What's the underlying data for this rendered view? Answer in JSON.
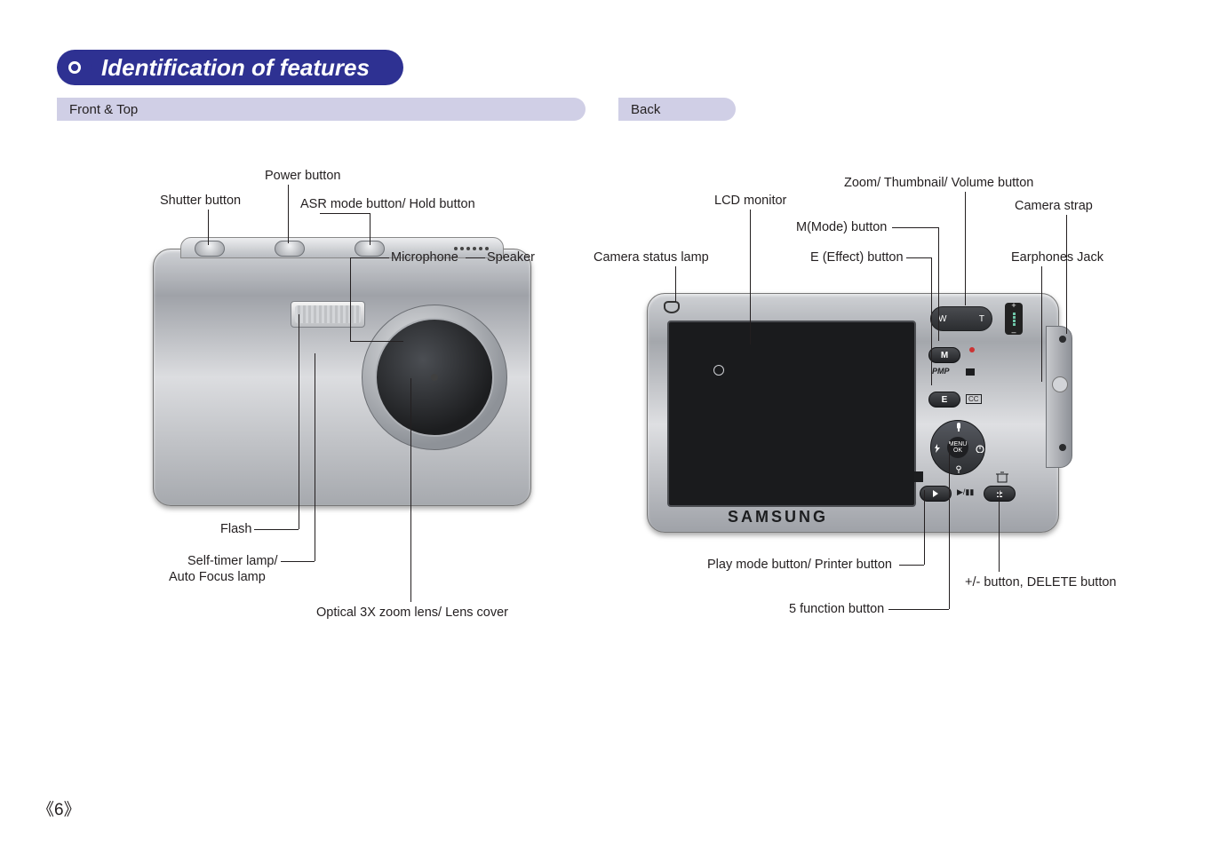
{
  "page_title": "Identification of features",
  "subsections": {
    "front": "Front & Top",
    "back": "Back"
  },
  "brand": "SAMSUNG",
  "page_number": "《6》",
  "front_labels": {
    "shutter": "Shutter button",
    "power": "Power button",
    "asr": "ASR mode button/ Hold button",
    "mic": "Microphone",
    "speaker": "Speaker",
    "flash": "Flash",
    "selftimer_l1": "Self-timer lamp/",
    "selftimer_l2": "Auto Focus lamp",
    "lens": "Optical 3X zoom lens/ Lens cover"
  },
  "back_labels": {
    "lcd": "LCD monitor",
    "zoom": "Zoom/ Thumbnail/ Volume button",
    "mode": "M(Mode) button",
    "strap": "Camera strap",
    "status": "Camera status lamp",
    "effect": "E (Effect) button",
    "ear": "Earphones Jack",
    "play": "Play mode button/ Printer button",
    "five": "5 function button",
    "plusminus": "+/- button, DELETE button"
  },
  "buttons": {
    "zoom_t": "T",
    "zoom_w": "W",
    "m": "M",
    "e": "E",
    "pmp": "PMP",
    "cc": "CC",
    "menu_l1": "MENU",
    "menu_l2": "OK"
  }
}
